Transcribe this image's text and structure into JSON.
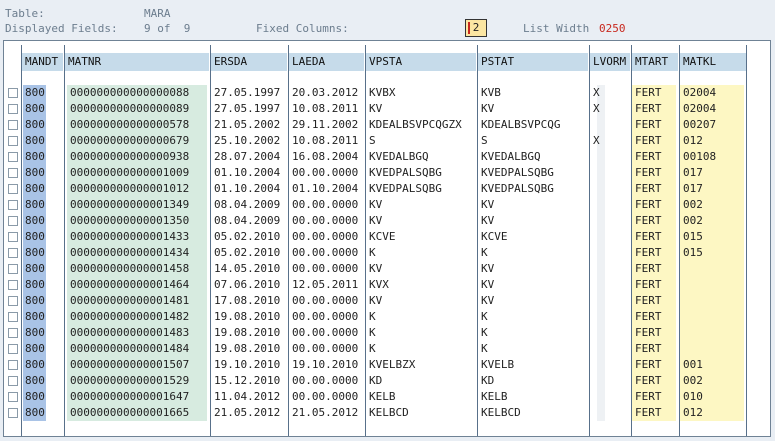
{
  "header": {
    "table_label": "Table:",
    "table_value": "MARA",
    "displayed_label": "Displayed Fields:",
    "displayed_value": "9 of  9",
    "fixed_label": "Fixed Columns:",
    "fixed_value": "2",
    "listwidth_label": "List Width",
    "listwidth_value": "0250"
  },
  "columns": [
    "MANDT",
    "MATNR",
    "ERSDA",
    "LAEDA",
    "VPSTA",
    "PSTAT",
    "LVORM",
    "MTART",
    "MATKL"
  ],
  "rows": [
    [
      "800",
      "000000000000000088",
      "27.05.1997",
      "20.03.2012",
      "KVBX",
      "KVB",
      "X",
      "FERT",
      "02004"
    ],
    [
      "800",
      "000000000000000089",
      "27.05.1997",
      "10.08.2011",
      "KV",
      "KV",
      "X",
      "FERT",
      "02004"
    ],
    [
      "800",
      "000000000000000578",
      "21.05.2002",
      "29.11.2002",
      "KDEALBSVPCQGZX",
      "KDEALBSVPCQG",
      "",
      "FERT",
      "00207"
    ],
    [
      "800",
      "000000000000000679",
      "25.10.2002",
      "10.08.2011",
      "S",
      "S",
      "X",
      "FERT",
      "012"
    ],
    [
      "800",
      "000000000000000938",
      "28.07.2004",
      "16.08.2004",
      "KVEDALBGQ",
      "KVEDALBGQ",
      "",
      "FERT",
      "00108"
    ],
    [
      "800",
      "000000000000001009",
      "01.10.2004",
      "00.00.0000",
      "KVEDPALSQBG",
      "KVEDPALSQBG",
      "",
      "FERT",
      "017"
    ],
    [
      "800",
      "000000000000001012",
      "01.10.2004",
      "01.10.2004",
      "KVEDPALSQBG",
      "KVEDPALSQBG",
      "",
      "FERT",
      "017"
    ],
    [
      "800",
      "000000000000001349",
      "08.04.2009",
      "00.00.0000",
      "KV",
      "KV",
      "",
      "FERT",
      "002"
    ],
    [
      "800",
      "000000000000001350",
      "08.04.2009",
      "00.00.0000",
      "KV",
      "KV",
      "",
      "FERT",
      "002"
    ],
    [
      "800",
      "000000000000001433",
      "05.02.2010",
      "00.00.0000",
      "KCVE",
      "KCVE",
      "",
      "FERT",
      "015"
    ],
    [
      "800",
      "000000000000001434",
      "05.02.2010",
      "00.00.0000",
      "K",
      "K",
      "",
      "FERT",
      "015"
    ],
    [
      "800",
      "000000000000001458",
      "14.05.2010",
      "00.00.0000",
      "KV",
      "KV",
      "",
      "FERT",
      ""
    ],
    [
      "800",
      "000000000000001464",
      "07.06.2010",
      "12.05.2011",
      "KVX",
      "KV",
      "",
      "FERT",
      ""
    ],
    [
      "800",
      "000000000000001481",
      "17.08.2010",
      "00.00.0000",
      "KV",
      "KV",
      "",
      "FERT",
      ""
    ],
    [
      "800",
      "000000000000001482",
      "19.08.2010",
      "00.00.0000",
      "K",
      "K",
      "",
      "FERT",
      ""
    ],
    [
      "800",
      "000000000000001483",
      "19.08.2010",
      "00.00.0000",
      "K",
      "K",
      "",
      "FERT",
      ""
    ],
    [
      "800",
      "000000000000001484",
      "19.08.2010",
      "00.00.0000",
      "K",
      "K",
      "",
      "FERT",
      ""
    ],
    [
      "800",
      "000000000000001507",
      "19.10.2010",
      "19.10.2010",
      "KVELBZX",
      "KVELB",
      "",
      "FERT",
      "001"
    ],
    [
      "800",
      "000000000000001529",
      "15.12.2010",
      "00.00.0000",
      "KD",
      "KD",
      "",
      "FERT",
      "002"
    ],
    [
      "800",
      "000000000000001647",
      "11.04.2012",
      "00.00.0000",
      "KELB",
      "KELB",
      "",
      "FERT",
      "010"
    ],
    [
      "800",
      "000000000000001665",
      "21.05.2012",
      "21.05.2012",
      "KELBCD",
      "KELBCD",
      "",
      "FERT",
      "012"
    ]
  ]
}
